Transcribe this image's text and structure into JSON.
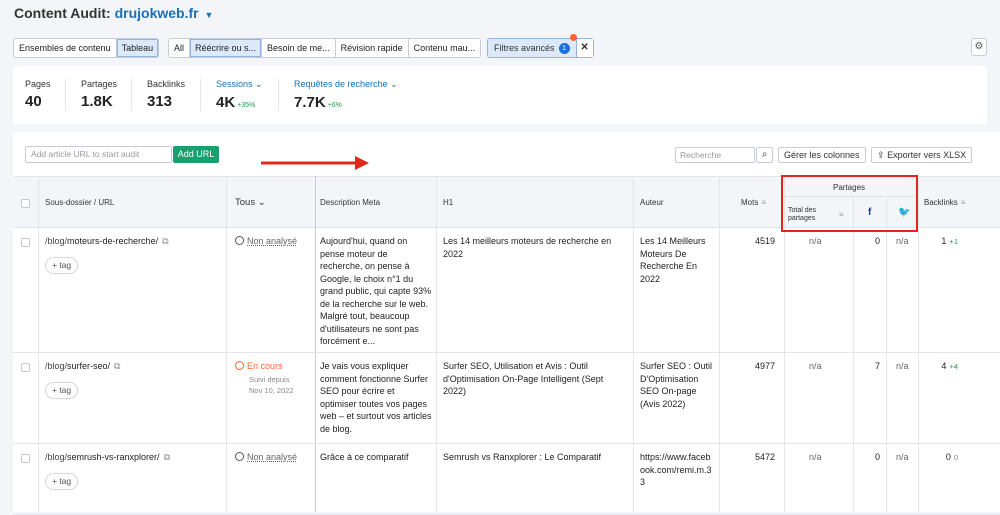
{
  "header": {
    "title": "Content Audit:",
    "domain": "drujokweb.fr"
  },
  "filters": {
    "view_group": [
      "Ensembles de contenu",
      "Tableau"
    ],
    "action_group": [
      "All",
      "Réécrire ou s...",
      "Besoin de me...",
      "Révision rapide",
      "Contenu mau..."
    ],
    "advanced_label": "Filtres avancés",
    "advanced_count": "1",
    "close": "✕",
    "settings": "⚙"
  },
  "stats": [
    {
      "label": "Pages",
      "value": "40",
      "delta": ""
    },
    {
      "label": "Partages",
      "value": "1.8K",
      "delta": ""
    },
    {
      "label": "Backlinks",
      "value": "313",
      "delta": ""
    },
    {
      "label": "Sessions",
      "value": "4K",
      "delta": "+35%"
    },
    {
      "label": "Requêtes de recherche",
      "value": "7.7K",
      "delta": "+6%"
    }
  ],
  "toolbar": {
    "url_placeholder": "Add article URL to start audit",
    "add_url": "Add URL",
    "search_placeholder": "Recherche",
    "manage_columns": "Gérer les colonnes",
    "export": "Exporter vers XLSX"
  },
  "columns": {
    "url": "Sous-dossier / URL",
    "status": "Tous",
    "meta": "Description Meta",
    "h1": "H1",
    "author": "Auteur",
    "words": "Mots",
    "shares_group": "Partages",
    "shares_total": "Total des partages",
    "backlinks": "Backlinks"
  },
  "rows": [
    {
      "path": "/blog/",
      "slug": "moteurs-de-recherche/",
      "tag": "+ tag",
      "status": "Non analysé",
      "status_sub1": "",
      "status_sub2": "",
      "meta": "Aujourd'hui, quand on pense moteur de recherche, on pense à Google, le choix n°1 du grand public, qui capte 93% de la recherche sur le web. Malgré tout, beaucoup d'utilisateurs ne sont pas forcément e...",
      "h1": "Les 14 meilleurs moteurs de recherche en 2022",
      "author": "Les 14 Meilleurs Moteurs De Recherche En 2022",
      "words": "4519",
      "shares_total": "n/a",
      "facebook": "0",
      "twitter": "n/a",
      "backlinks": "1",
      "backlinks_delta": "+1"
    },
    {
      "path": "/blog/",
      "slug": "surfer-seo/",
      "tag": "+ tag",
      "status": "En cours",
      "status_sub1": "Suivi depuis",
      "status_sub2": "Nov 10, 2022",
      "meta": "Je vais vous expliquer comment fonctionne Surfer SEO pour écrire et optimiser toutes vos pages web – et surtout vos articles de blog.",
      "h1": "Surfer SEO, Utilisation et Avis : Outil d'Optimisation On-Page Intelligent (Sept 2022)",
      "author": "Surfer SEO : Outil D'Optimisation SEO On-page (Avis 2022)",
      "words": "4977",
      "shares_total": "n/a",
      "facebook": "7",
      "twitter": "n/a",
      "backlinks": "4",
      "backlinks_delta": "+4"
    },
    {
      "path": "/blog/",
      "slug": "semrush-vs-ranxplorer/",
      "tag": "+ tag",
      "status": "Non analysé",
      "status_sub1": "",
      "status_sub2": "",
      "meta": "Grâce à ce comparatif",
      "h1": "Semrush vs Ranxplorer : Le Comparatif",
      "author": "https://www.facebook.com/remi.m.33",
      "words": "5472",
      "shares_total": "n/a",
      "facebook": "0",
      "twitter": "n/a",
      "backlinks": "0",
      "backlinks_delta": "0"
    }
  ],
  "colors": {
    "accent": "#1a6fb5",
    "green": "#1b9f6d",
    "orange": "#ff642d",
    "red_annotation": "#e3261b"
  }
}
